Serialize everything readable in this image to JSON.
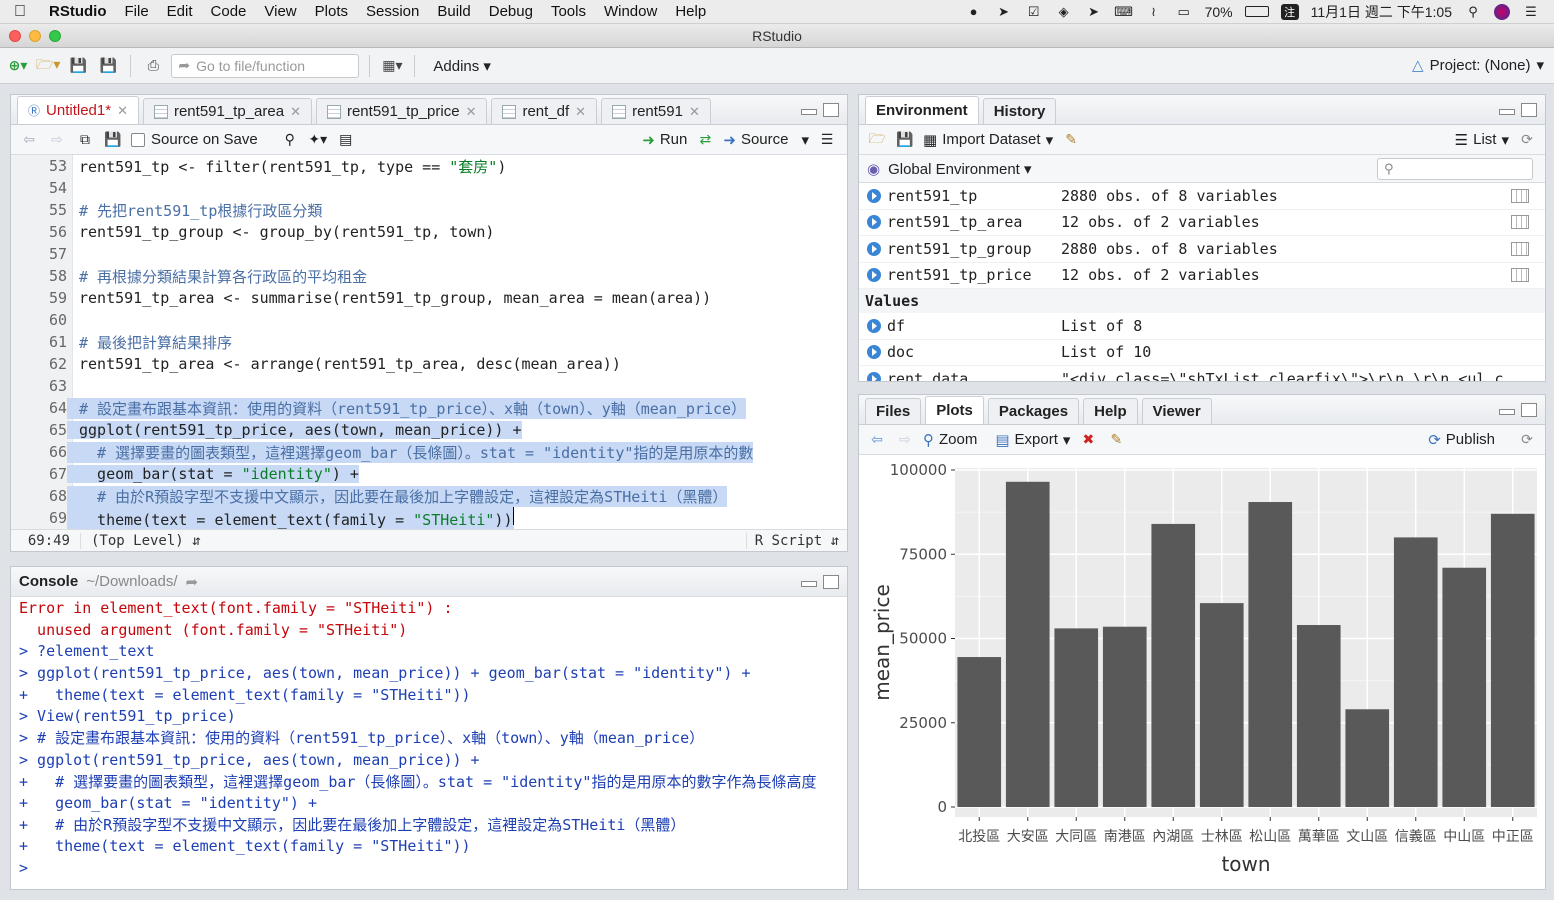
{
  "menubar": {
    "app": "RStudio",
    "items": [
      "File",
      "Edit",
      "Code",
      "View",
      "Plots",
      "Session",
      "Build",
      "Debug",
      "Tools",
      "Window",
      "Help"
    ],
    "battery": "70%",
    "clock": "11月1日 週二 下午1:05"
  },
  "window": {
    "title": "RStudio"
  },
  "toolbar": {
    "goto_placeholder": "Go to file/function",
    "addins": "Addins",
    "project": "Project: (None)"
  },
  "source": {
    "tabs": [
      "Untitled1*",
      "rent591_tp_area",
      "rent591_tp_price",
      "rent_df",
      "rent591"
    ],
    "source_on_save": "Source on Save",
    "run": "Run",
    "source": "Source",
    "lines": [
      {
        "n": "53",
        "parts": [
          [
            "kw",
            "rent591_tp <- filter(rent591_tp, type == "
          ],
          [
            "str",
            "\"套房\""
          ],
          [
            "kw",
            ")"
          ]
        ]
      },
      {
        "n": "54",
        "parts": []
      },
      {
        "n": "55",
        "parts": [
          [
            "cm",
            "# 先把rent591_tp根據行政區分類"
          ]
        ]
      },
      {
        "n": "56",
        "parts": [
          [
            "kw",
            "rent591_tp_group <- group_by(rent591_tp, town)"
          ]
        ]
      },
      {
        "n": "57",
        "parts": []
      },
      {
        "n": "58",
        "parts": [
          [
            "cm",
            "# 再根據分類結果計算各行政區的平均租金"
          ]
        ]
      },
      {
        "n": "59",
        "parts": [
          [
            "kw",
            "rent591_tp_area <- summarise(rent591_tp_group, mean_area = mean(area))"
          ]
        ]
      },
      {
        "n": "60",
        "parts": []
      },
      {
        "n": "61",
        "parts": [
          [
            "cm",
            "# 最後把計算結果排序"
          ]
        ]
      },
      {
        "n": "62",
        "parts": [
          [
            "kw",
            "rent591_tp_area <- arrange(rent591_tp_area, desc(mean_area))"
          ]
        ]
      },
      {
        "n": "63",
        "parts": []
      },
      {
        "n": "64",
        "sel": true,
        "parts": [
          [
            "cm",
            "# 設定畫布跟基本資訊：使用的資料（rent591_tp_price）、x軸（town）、y軸（mean_price）"
          ]
        ]
      },
      {
        "n": "65",
        "sel": true,
        "parts": [
          [
            "kw",
            "ggplot(rent591_tp_price, aes(town, mean_price)) +"
          ]
        ]
      },
      {
        "n": "66",
        "sel": true,
        "parts": [
          [
            "cm",
            "  # 選擇要畫的圖表類型，這裡選擇geom_bar（長條圖）。stat = \"identity\"指的是用原本的數"
          ]
        ]
      },
      {
        "n": "67",
        "sel": true,
        "parts": [
          [
            "kw",
            "  geom_bar(stat = "
          ],
          [
            "str",
            "\"identity\""
          ],
          [
            "kw",
            ") +"
          ]
        ]
      },
      {
        "n": "68",
        "sel": true,
        "parts": [
          [
            "cm",
            "  # 由於R預設字型不支援中文顯示，因此要在最後加上字體設定，這裡設定為STHeiti（黑體）"
          ]
        ]
      },
      {
        "n": "69",
        "sel": true,
        "parts": [
          [
            "kw",
            "  theme(text = element_text(family = "
          ],
          [
            "str",
            "\"STHeiti\""
          ],
          [
            "kw",
            "))"
          ]
        ]
      }
    ],
    "cursor": "69:49",
    "scope": "(Top Level)",
    "filetype": "R Script"
  },
  "console": {
    "title": "Console",
    "path": "~/Downloads/",
    "lines": [
      {
        "c": "err",
        "t": "Error in element_text(font.family = \"STHeiti\") :"
      },
      {
        "c": "err",
        "t": "  unused argument (font.family = \"STHeiti\")"
      },
      {
        "c": "inp",
        "t": "> ?element_text"
      },
      {
        "c": "inp",
        "t": "> ggplot(rent591_tp_price, aes(town, mean_price)) + geom_bar(stat = \"identity\") +"
      },
      {
        "c": "inp",
        "t": "+   theme(text = element_text(family = \"STHeiti\"))"
      },
      {
        "c": "inp",
        "t": "> View(rent591_tp_price)"
      },
      {
        "c": "inp",
        "t": "> # 設定畫布跟基本資訊：使用的資料（rent591_tp_price）、x軸（town）、y軸（mean_price）"
      },
      {
        "c": "inp",
        "t": "> ggplot(rent591_tp_price, aes(town, mean_price)) +"
      },
      {
        "c": "inp",
        "t": "+   # 選擇要畫的圖表類型，這裡選擇geom_bar（長條圖）。stat = \"identity\"指的是用原本的數字作為長條高度"
      },
      {
        "c": "inp",
        "t": "+   geom_bar(stat = \"identity\") +"
      },
      {
        "c": "inp",
        "t": "+   # 由於R預設字型不支援中文顯示，因此要在最後加上字體設定，這裡設定為STHeiti（黑體）"
      },
      {
        "c": "inp",
        "t": "+   theme(text = element_text(family = \"STHeiti\"))"
      },
      {
        "c": "inp",
        "t": "> "
      }
    ]
  },
  "environment": {
    "tabs": [
      "Environment",
      "History"
    ],
    "import": "Import Dataset",
    "view_mode": "List",
    "scope": "Global Environment",
    "data": [
      {
        "name": "rent591_tp",
        "value": "2880 obs. of 8 variables"
      },
      {
        "name": "rent591_tp_area",
        "value": "12 obs. of 2 variables"
      },
      {
        "name": "rent591_tp_group",
        "value": "2880 obs. of 8 variables"
      },
      {
        "name": "rent591_tp_price",
        "value": "12 obs. of 2 variables"
      }
    ],
    "values_header": "Values",
    "values": [
      {
        "name": "df",
        "value": "List of 8"
      },
      {
        "name": "doc",
        "value": "List of 10"
      },
      {
        "name": "rent_data",
        "value": "\"<div class=\\\"shTxList clearfix\\\">\\r\\n \\r\\n <ul c"
      }
    ]
  },
  "plots": {
    "tabs": [
      "Files",
      "Plots",
      "Packages",
      "Help",
      "Viewer"
    ],
    "zoom": "Zoom",
    "export": "Export",
    "publish": "Publish"
  },
  "chart_data": {
    "type": "bar",
    "xlabel": "town",
    "ylabel": "mean_price",
    "categories": [
      "北投區",
      "大安區",
      "大同區",
      "南港區",
      "內湖區",
      "士林區",
      "松山區",
      "萬華區",
      "文山區",
      "信義區",
      "中山區",
      "中正區"
    ],
    "values": [
      44500,
      96500,
      53000,
      53500,
      84000,
      60500,
      90500,
      54000,
      29000,
      80000,
      71000,
      87000
    ],
    "ylim": [
      0,
      100000
    ],
    "yticks": [
      0,
      25000,
      50000,
      75000,
      100000
    ],
    "ytick_labels": [
      "0",
      "25000",
      "50000",
      "75000",
      "100000"
    ],
    "bar_color": "#595959",
    "panel_color": "#ebebeb",
    "grid": true
  },
  "colors": {
    "selection": "#c7d9f5",
    "comment": "#4a6fa5",
    "string": "#0a7d28",
    "error": "#c5060b",
    "console_input": "#1d3fb3"
  }
}
